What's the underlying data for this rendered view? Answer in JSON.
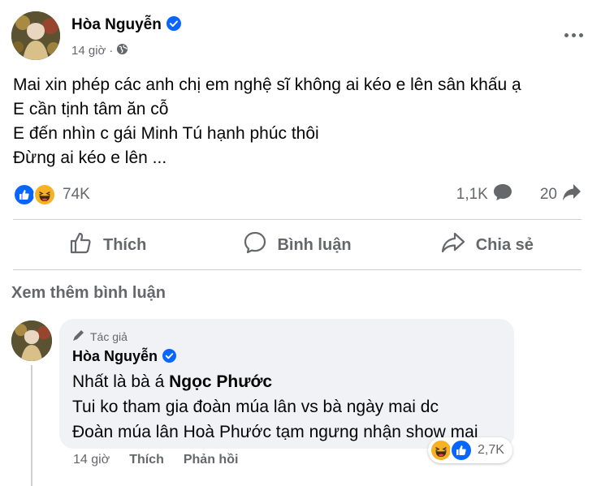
{
  "post": {
    "author": "Hòa Nguyễn",
    "time": "14 giờ",
    "privacy_icon": "globe-icon",
    "body_lines": [
      "Mai xin phép các anh chị em nghệ sĩ không ai kéo e lên sân khấu ạ",
      "E cần tịnh tâm ăn cỗ",
      "E đến nhìn c gái Minh Tú hạnh phúc thôi",
      "Đừng ai kéo e lên ..."
    ]
  },
  "stats": {
    "reactions": [
      "like",
      "haha"
    ],
    "reaction_count": "74K",
    "comments": "1,1K",
    "shares": "20"
  },
  "actions": {
    "like": "Thích",
    "comment": "Bình luận",
    "share": "Chia sẻ"
  },
  "view_more_comments": "Xem thêm bình luận",
  "comment": {
    "badge": "Tác giả",
    "author": "Hòa Nguyễn",
    "line1_prefix": "Nhất là bà á ",
    "mention": "Ngọc Phước",
    "line2": "Tui ko tham gia đoàn múa lân vs bà ngày mai dc",
    "line3": "Đoàn múa lân Hoà Phước tạm ngưng nhận show mai",
    "reactions": [
      "haha",
      "like"
    ],
    "reaction_count": "2,7K",
    "time": "14 giờ",
    "like_label": "Thích",
    "reply_label": "Phản hồi"
  },
  "colors": {
    "facebook_blue": "#0866ff",
    "secondary_text": "#65676b",
    "bubble": "#f0f2f5"
  }
}
